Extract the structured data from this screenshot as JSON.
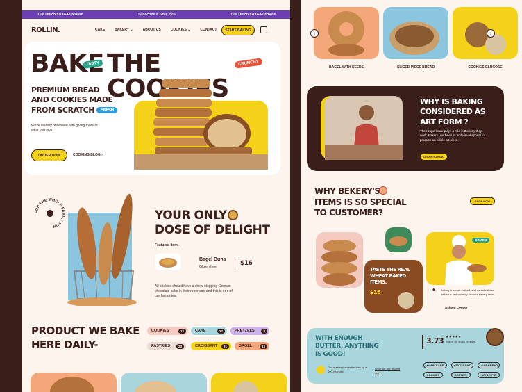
{
  "promo": {
    "left": "15% Off on $100+ Purchase",
    "center": "Subscribe & Save 15%",
    "right": "15% Off on $100+ Purchase"
  },
  "brand": "ROLLIN.",
  "nav": {
    "items": [
      "CAKE",
      "BAKERY",
      "ABOUT US",
      "COOKIES",
      "CONTACT"
    ],
    "cta": "START BAKING"
  },
  "hero": {
    "title_1": "BAKE",
    "title_2": "THE COOKIES",
    "tag_tasty": "TASTY",
    "tag_crunchy": "CRUNCHY",
    "subtitle_1": "PREMIUM BREAD",
    "subtitle_2": "AND COOKIES MADE",
    "subtitle_3": "FROM SCRATCH",
    "tag_fresh": "FRESH",
    "desc": "We're literally obsessed with giving more of what you love!",
    "order_now": "ORDER NOW",
    "cooking_blog": "COOKING BLOG"
  },
  "delight": {
    "circle_text": "FOR THE WHOLE FAMILY FUN",
    "title_1": "YOUR ONLY",
    "title_2": "DOSE OF DELIGHT",
    "featured_label": "Featured Item -",
    "item_name": "Bagel Buns",
    "item_sub": "Gluten free",
    "item_price": "$16",
    "desc": "All cookies should have a show-stopping German chocolate cake in their repertoire and this is one of our favourites."
  },
  "products": {
    "title_1": "PRODUCT WE BAKE",
    "title_2": "HERE DAILY-",
    "categories": [
      {
        "label": "COOKIES",
        "count": "12",
        "color": "#f4c9c0"
      },
      {
        "label": "CAKE",
        "count": "27",
        "color": "#a9d6dc"
      },
      {
        "label": "PRETZELS",
        "count": "8",
        "color": "#cbb3ea"
      },
      {
        "label": "PASTRIES",
        "count": "23",
        "color": "#e8dcd4"
      },
      {
        "label": "CROISSANT",
        "count": "21",
        "color": "#f5d21a"
      },
      {
        "label": "BAGEL",
        "count": "13",
        "color": "#f4a77a"
      }
    ]
  },
  "carousel": {
    "items": [
      "BAGEL WITH SEEDS",
      "SLICED PIECE BREAD",
      "COOKIES GLUCOSE"
    ]
  },
  "art": {
    "title_1": "WHY IS BAKING",
    "title_2": "CONSIDERED AS",
    "title_3": "ART FORM ?",
    "desc": "Their experience plays a role in the way they work. Bakers use flavours and visual appeal to produce an edible art piece.",
    "cta": "LEARN BAKING"
  },
  "special": {
    "title_1": "WHY BEKERY'S",
    "title_2": "ITEMS IS SO SPECIAL",
    "title_3": "TO CUSTOMER?",
    "cta": "SHOP NOW",
    "taste_1": "TASTE THE REAL",
    "taste_2": "WHEAT BAKED",
    "taste_3": "ITEMS.",
    "taste_price": "$16",
    "combo": "COMBO",
    "quote": "Baking is a craft in itself, and we take these delicious and crumbly flavours bakery items.",
    "author": "Ashton Cooper"
  },
  "butter": {
    "title_1": "WITH ENOUGH",
    "title_2": "BUTTER, ANYTHING",
    "title_3": "IS GOOD!",
    "rating": "3.73",
    "stars": "★★★★★",
    "reviews": "Based on 4,950 reviews.",
    "plan": "Our master plan to freshen up a 200-year-old",
    "dishing": "What we are dishing out ?",
    "chips": [
      "PLAIN CAKE",
      "CROISSANT",
      "LOAF BREAD",
      "COOKIES",
      "BRETZEL",
      "APPLE PIE"
    ]
  }
}
